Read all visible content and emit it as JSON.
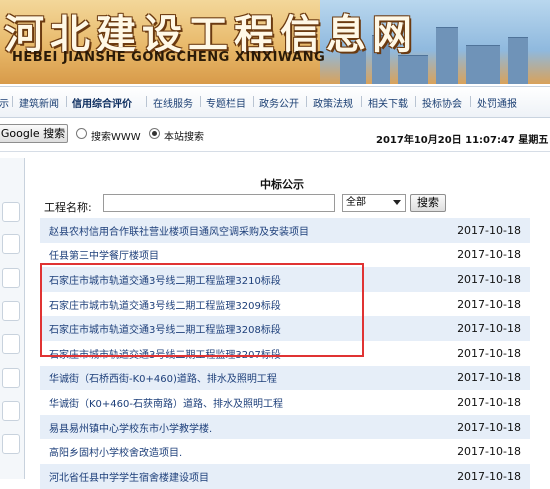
{
  "banner": {
    "title_cn": "河北建设工程信息网",
    "title_en": "HEBEI JIANSHE GONGCHENG XINXIWANG"
  },
  "nav": {
    "items": [
      {
        "label": "示"
      },
      {
        "label": "建筑新闻"
      },
      {
        "label": "信用综合评价"
      },
      {
        "label": "在线服务"
      },
      {
        "label": "专题栏目"
      },
      {
        "label": "政务公开"
      },
      {
        "label": "政策法规"
      },
      {
        "label": "相关下载"
      },
      {
        "label": "投标协会"
      },
      {
        "label": "处罚通报"
      }
    ],
    "active_index": 2
  },
  "search": {
    "button_label": "Google 搜索",
    "option_www": "搜索WWW",
    "option_site": "本站搜索",
    "selected": "site"
  },
  "datetime": "2017年10月20日 11:07:47 星期五",
  "main": {
    "title": "中标公示",
    "filter_label": "工程名称:",
    "filter_value": "",
    "select_value": "全部",
    "search_button": "搜索",
    "rows": [
      {
        "title": "赵县农村信用合作联社营业楼项目通风空调采购及安装项目",
        "date": "2017-10-18"
      },
      {
        "title": "任县第三中学餐厅楼项目",
        "date": "2017-10-18"
      },
      {
        "title": "石家庄市城市轨道交通3号线二期工程监理3210标段",
        "date": "2017-10-18"
      },
      {
        "title": "石家庄市城市轨道交通3号线二期工程监理3209标段",
        "date": "2017-10-18"
      },
      {
        "title": "石家庄市城市轨道交通3号线二期工程监理3208标段",
        "date": "2017-10-18"
      },
      {
        "title": "石家庄市城市轨道交通3号线二期工程监理3207标段",
        "date": "2017-10-18"
      },
      {
        "title": "华诚街（石桥西街-K0+460)道路、排水及照明工程",
        "date": "2017-10-18"
      },
      {
        "title": "华诚街（K0+460-石获南路）道路、排水及照明工程",
        "date": "2017-10-18"
      },
      {
        "title": "易县易州镇中心学校东市小学教学楼.",
        "date": "2017-10-18"
      },
      {
        "title": "高阳乡固村小学校舍改造项目.",
        "date": "2017-10-18"
      },
      {
        "title": "河北省任县中学学生宿舍楼建设项目",
        "date": "2017-10-18"
      }
    ]
  },
  "colors": {
    "link": "#1d3f7a",
    "row_alt": "#e6eef8",
    "highlight": "#e03333"
  }
}
